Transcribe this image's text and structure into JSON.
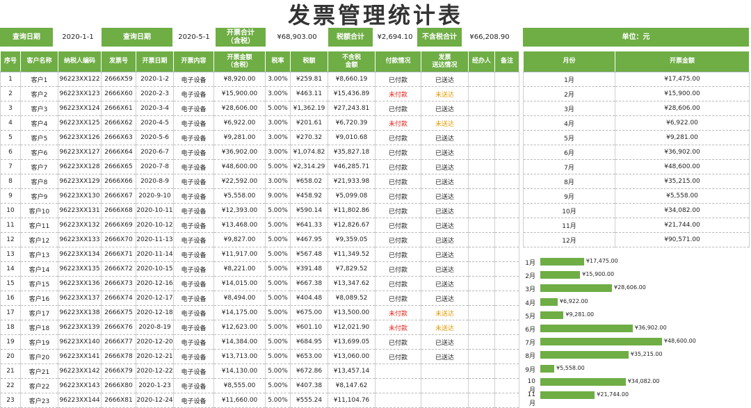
{
  "title": "发票管理统计表",
  "filters": {
    "query_label_1": "查询日期",
    "query_value_1": "2020-1-1",
    "query_label_2": "查询日期",
    "query_value_2": "2020-5-1",
    "total_tax_incl_label": "开票合计\n（含税）",
    "total_tax_incl_value": "¥68,903.00",
    "tax_total_label": "税额合计",
    "tax_total_value": "¥2,694.10",
    "total_excl_label": "不含税合计",
    "total_excl_value": "¥66,208.90",
    "unit_label": "单位：元"
  },
  "colors": {
    "accent": "#6fad45",
    "unpaid": "#e0251b",
    "not_delivered": "#e09b00"
  },
  "main_table": {
    "headers": [
      "序号",
      "客户名称",
      "纳税人编码",
      "发票号",
      "开票日期",
      "开票内容",
      "开票金额\n（含税）",
      "税率",
      "税额",
      "不含税\n金额",
      "付款情况",
      "发票\n送达情况",
      "经办人",
      "备注"
    ],
    "rows": [
      [
        "1",
        "客户1",
        "96223XX122",
        "2666X59",
        "2020-1-2",
        "电子设备",
        "¥8,920.00",
        "3.00%",
        "¥259.81",
        "¥8,660.19",
        "已付款",
        "已送达",
        "",
        ""
      ],
      [
        "2",
        "客户2",
        "96223XX123",
        "2666X60",
        "2020-2-3",
        "电子设备",
        "¥15,900.00",
        "3.00%",
        "¥463.11",
        "¥15,436.89",
        "未付款",
        "未送达",
        "",
        ""
      ],
      [
        "3",
        "客户3",
        "96223XX124",
        "2666X61",
        "2020-3-4",
        "电子设备",
        "¥28,606.00",
        "5.00%",
        "¥1,362.19",
        "¥27,243.81",
        "已付款",
        "已送达",
        "",
        ""
      ],
      [
        "4",
        "客户4",
        "96223XX125",
        "2666X62",
        "2020-4-5",
        "电子设备",
        "¥6,922.00",
        "3.00%",
        "¥201.61",
        "¥6,720.39",
        "未付款",
        "未送达",
        "",
        ""
      ],
      [
        "5",
        "客户5",
        "96223XX126",
        "2666X63",
        "2020-5-6",
        "电子设备",
        "¥9,281.00",
        "3.00%",
        "¥270.32",
        "¥9,010.68",
        "已付款",
        "已送达",
        "",
        ""
      ],
      [
        "6",
        "客户6",
        "96223XX127",
        "2666X64",
        "2020-6-7",
        "电子设备",
        "¥36,902.00",
        "3.00%",
        "¥1,074.82",
        "¥35,827.18",
        "已付款",
        "已送达",
        "",
        ""
      ],
      [
        "7",
        "客户7",
        "96223XX128",
        "2666X65",
        "2020-7-8",
        "电子设备",
        "¥48,600.00",
        "5.00%",
        "¥2,314.29",
        "¥46,285.71",
        "已付款",
        "已送达",
        "",
        ""
      ],
      [
        "8",
        "客户8",
        "96223XX129",
        "2666X66",
        "2020-8-9",
        "电子设备",
        "¥22,592.00",
        "3.00%",
        "¥658.02",
        "¥21,933.98",
        "已付款",
        "已送达",
        "",
        ""
      ],
      [
        "9",
        "客户9",
        "96223XX130",
        "2666X67",
        "2020-9-10",
        "电子设备",
        "¥5,558.00",
        "9.00%",
        "¥458.92",
        "¥5,099.08",
        "已付款",
        "已送达",
        "",
        ""
      ],
      [
        "10",
        "客户10",
        "96223XX131",
        "2666X68",
        "2020-10-11",
        "电子设备",
        "¥12,393.00",
        "5.00%",
        "¥590.14",
        "¥11,802.86",
        "已付款",
        "已送达",
        "",
        ""
      ],
      [
        "11",
        "客户11",
        "96223XX132",
        "2666X69",
        "2020-10-12",
        "电子设备",
        "¥13,468.00",
        "5.00%",
        "¥641.33",
        "¥12,826.67",
        "已付款",
        "已送达",
        "",
        ""
      ],
      [
        "12",
        "客户12",
        "96223XX133",
        "2666X70",
        "2020-11-13",
        "电子设备",
        "¥9,827.00",
        "5.00%",
        "¥467.95",
        "¥9,359.05",
        "已付款",
        "已送达",
        "",
        ""
      ],
      [
        "13",
        "客户13",
        "96223XX134",
        "2666X71",
        "2020-11-14",
        "电子设备",
        "¥11,917.00",
        "5.00%",
        "¥567.48",
        "¥11,349.52",
        "已付款",
        "已送达",
        "",
        ""
      ],
      [
        "14",
        "客户14",
        "96223XX135",
        "2666X72",
        "2020-10-15",
        "电子设备",
        "¥8,221.00",
        "5.00%",
        "¥391.48",
        "¥7,829.52",
        "已付款",
        "已送达",
        "",
        ""
      ],
      [
        "15",
        "客户15",
        "96223XX136",
        "2666X73",
        "2020-12-16",
        "电子设备",
        "¥14,015.00",
        "5.00%",
        "¥667.38",
        "¥13,347.62",
        "已付款",
        "已送达",
        "",
        ""
      ],
      [
        "16",
        "客户16",
        "96223XX137",
        "2666X74",
        "2020-12-17",
        "电子设备",
        "¥8,494.00",
        "5.00%",
        "¥404.48",
        "¥8,089.52",
        "已付款",
        "已送达",
        "",
        ""
      ],
      [
        "17",
        "客户17",
        "96223XX138",
        "2666X75",
        "2020-12-18",
        "电子设备",
        "¥14,175.00",
        "5.00%",
        "¥675.00",
        "¥13,500.00",
        "未付款",
        "未送达",
        "",
        ""
      ],
      [
        "18",
        "客户18",
        "96223XX139",
        "2666X76",
        "2020-8-19",
        "电子设备",
        "¥12,623.00",
        "5.00%",
        "¥601.10",
        "¥12,021.90",
        "未付款",
        "未送达",
        "",
        ""
      ],
      [
        "19",
        "客户19",
        "96223XX140",
        "2666X77",
        "2020-12-20",
        "电子设备",
        "¥14,384.00",
        "5.00%",
        "¥684.95",
        "¥13,699.05",
        "已付款",
        "已送达",
        "",
        ""
      ],
      [
        "20",
        "客户20",
        "96223XX141",
        "2666X78",
        "2020-12-21",
        "电子设备",
        "¥13,713.00",
        "5.00%",
        "¥653.00",
        "¥13,060.00",
        "已付款",
        "已送达",
        "",
        ""
      ],
      [
        "21",
        "客户21",
        "96223XX142",
        "2666X79",
        "2020-12-22",
        "电子设备",
        "¥14,130.00",
        "5.00%",
        "¥672.86",
        "¥13,457.14",
        "",
        "",
        "",
        ""
      ],
      [
        "22",
        "客户22",
        "96223XX143",
        "2666X80",
        "2020-1-23",
        "电子设备",
        "¥8,555.00",
        "5.00%",
        "¥407.38",
        "¥8,147.62",
        "",
        "",
        "",
        ""
      ],
      [
        "23",
        "客户23",
        "96223XX144",
        "2666X81",
        "2020-12-24",
        "电子设备",
        "¥11,660.00",
        "5.00%",
        "¥555.24",
        "¥11,104.76",
        "",
        "",
        "",
        ""
      ]
    ]
  },
  "month_table": {
    "headers": [
      "月份",
      "开票金额"
    ],
    "rows": [
      [
        "1月",
        "¥17,475.00"
      ],
      [
        "2月",
        "¥15,900.00"
      ],
      [
        "3月",
        "¥28,606.00"
      ],
      [
        "4月",
        "¥6,922.00"
      ],
      [
        "5月",
        "¥9,281.00"
      ],
      [
        "6月",
        "¥36,902.00"
      ],
      [
        "7月",
        "¥48,600.00"
      ],
      [
        "8月",
        "¥35,215.00"
      ],
      [
        "9月",
        "¥5,558.00"
      ],
      [
        "10月",
        "¥34,082.00"
      ],
      [
        "11月",
        "¥21,744.00"
      ],
      [
        "12月",
        "¥90,571.00"
      ]
    ]
  },
  "chart_data": {
    "type": "bar",
    "orientation": "horizontal",
    "categories": [
      "1月",
      "2月",
      "3月",
      "4月",
      "5月",
      "6月",
      "7月",
      "8月",
      "9月",
      "10月",
      "11月"
    ],
    "values": [
      17475,
      15900,
      28606,
      6922,
      9281,
      36902,
      48600,
      35215,
      5558,
      34082,
      21744
    ],
    "value_labels": [
      "¥17,475.00",
      "¥15,900.00",
      "¥28,606.00",
      "¥6,922.00",
      "¥9,281.00",
      "¥36,902.00",
      "¥48,600.00",
      "¥35,215.00",
      "¥5,558.00",
      "¥34,082.00",
      "¥21,744.00"
    ],
    "title": "",
    "xlabel": "",
    "ylabel": ""
  }
}
